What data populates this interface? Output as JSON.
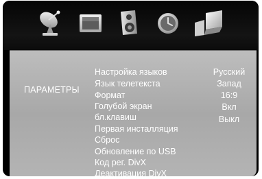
{
  "toolbar": {
    "icons": [
      "satellite-dish-icon",
      "picture-icon",
      "speaker-icon",
      "clock-icon",
      "parameters-icon"
    ]
  },
  "menu": {
    "section_title": "ПАРАМЕТРЫ",
    "items": [
      {
        "label": "Настройка языков",
        "value": "Русский"
      },
      {
        "label": "Язык телетекста",
        "value": "Запад"
      },
      {
        "label": "Формат",
        "value": "16:9"
      },
      {
        "label": "Голубой экран",
        "value": "Вкл"
      },
      {
        "label": "бл.клавиш",
        "value": "Выкл"
      },
      {
        "label": "Первая инсталляция",
        "value": ""
      },
      {
        "label": "Сброс",
        "value": ""
      },
      {
        "label": "Обновление по USB",
        "value": ""
      },
      {
        "label": "Код рег. DivX",
        "value": ""
      },
      {
        "label": "Деактивация DivX",
        "value": ""
      }
    ]
  }
}
